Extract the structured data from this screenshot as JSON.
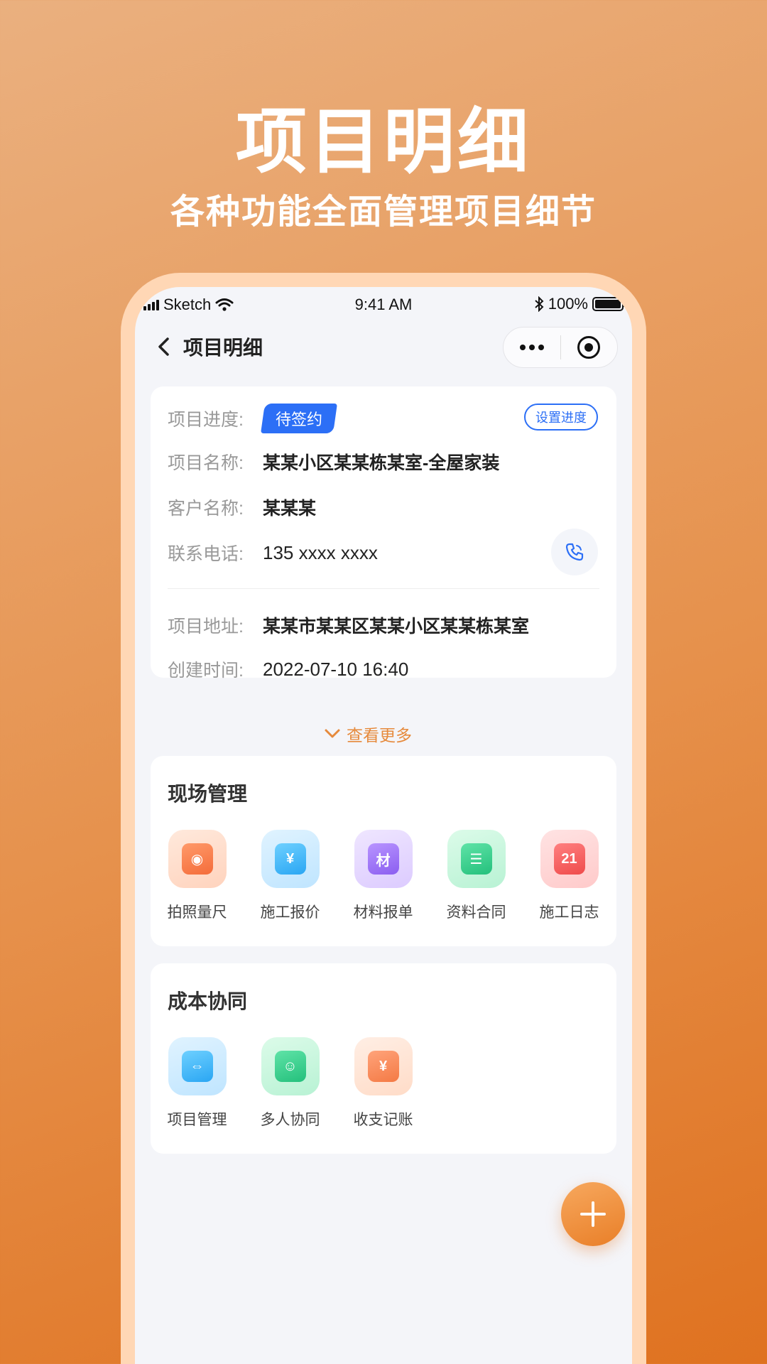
{
  "promo": {
    "title": "项目明细",
    "subtitle": "各种功能全面管理项目细节"
  },
  "status_bar": {
    "carrier": "Sketch",
    "time": "9:41 AM",
    "battery": "100%",
    "battery_level": 1.0
  },
  "nav": {
    "title": "项目明细",
    "back_icon": "chevron-left-icon",
    "more_icon": "more-dots-icon",
    "close_icon": "target-circle-icon"
  },
  "project_info": {
    "progress_label": "项目进度:",
    "progress_value": "待签约",
    "set_progress_button": "设置进度",
    "name_label": "项目名称:",
    "name_value": "某某小区某某栋某室-全屋家装",
    "customer_label": "客户名称:",
    "customer_value": "某某某",
    "phone_label": "联系电话:",
    "phone_value": "135 xxxx xxxx",
    "address_label": "项目地址:",
    "address_value": "某某市某某区某某小区某某栋某室",
    "created_label": "创建时间:",
    "created_value": "2022-07-10  16:40",
    "see_more": "查看更多"
  },
  "site_management": {
    "title": "现场管理",
    "items": [
      {
        "label": "拍照量尺",
        "icon": "camera-icon",
        "glyph": "◉"
      },
      {
        "label": "施工报价",
        "icon": "quote-yen-icon",
        "glyph": "¥"
      },
      {
        "label": "材料报单",
        "icon": "material-icon",
        "glyph": "材"
      },
      {
        "label": "资料合同",
        "icon": "contract-icon",
        "glyph": "☰"
      },
      {
        "label": "施工日志",
        "icon": "calendar-icon",
        "glyph": "21"
      }
    ]
  },
  "cost_collaboration": {
    "title": "成本协同",
    "items": [
      {
        "label": "项目管理",
        "icon": "briefcase-icon",
        "glyph": "⇔"
      },
      {
        "label": "多人协同",
        "icon": "users-icon",
        "glyph": "☺"
      },
      {
        "label": "收支记账",
        "icon": "ledger-yen-icon",
        "glyph": "¥"
      }
    ]
  },
  "colors": {
    "accent_blue": "#2c6ff6",
    "accent_orange": "#e68a3c"
  }
}
